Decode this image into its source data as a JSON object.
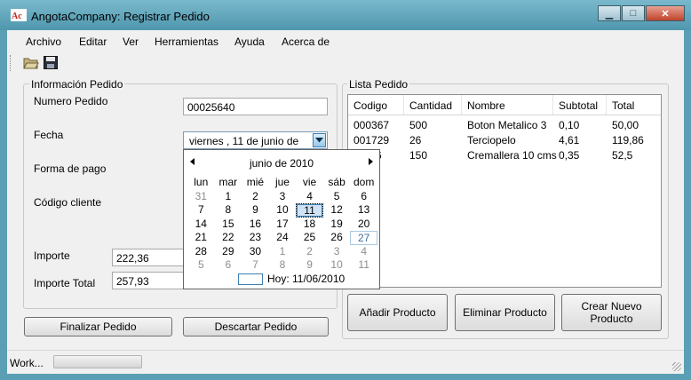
{
  "window": {
    "title": "AngotaCompany: Registrar Pedido",
    "controls": {
      "minimize": "▁",
      "maximize": "□",
      "close": "✕"
    }
  },
  "menu": [
    "Archivo",
    "Editar",
    "Ver",
    "Herramientas",
    "Ayuda",
    "Acerca de"
  ],
  "toolbar": {
    "icons": [
      "folder-open-icon",
      "save-icon"
    ]
  },
  "info_group": {
    "title": "Información Pedido",
    "numero_pedido_label": "Numero Pedido",
    "numero_pedido_value": "00025640",
    "fecha_label": "Fecha",
    "fecha_value": "viernes , 11 de     junio     de",
    "forma_pago_label": "Forma de pago",
    "codigo_cliente_label": "Código cliente",
    "importe_label": "Importe",
    "importe_value": "222,36",
    "importe_total_label": "Importe Total",
    "importe_total_value": "257,93"
  },
  "calendar": {
    "month_title": "junio de 2010",
    "days_of_week": [
      "lun",
      "mar",
      "mié",
      "jue",
      "vie",
      "sáb",
      "dom"
    ],
    "weeks": [
      [
        {
          "d": "31",
          "o": true
        },
        {
          "d": "1"
        },
        {
          "d": "2"
        },
        {
          "d": "3"
        },
        {
          "d": "4"
        },
        {
          "d": "5"
        },
        {
          "d": "6"
        }
      ],
      [
        {
          "d": "7"
        },
        {
          "d": "8"
        },
        {
          "d": "9"
        },
        {
          "d": "10"
        },
        {
          "d": "11",
          "s": true
        },
        {
          "d": "12"
        },
        {
          "d": "13"
        }
      ],
      [
        {
          "d": "14"
        },
        {
          "d": "15"
        },
        {
          "d": "16"
        },
        {
          "d": "17"
        },
        {
          "d": "18"
        },
        {
          "d": "19"
        },
        {
          "d": "20"
        }
      ],
      [
        {
          "d": "21"
        },
        {
          "d": "22"
        },
        {
          "d": "23"
        },
        {
          "d": "24"
        },
        {
          "d": "25"
        },
        {
          "d": "26"
        },
        {
          "d": "27",
          "t": true
        }
      ],
      [
        {
          "d": "28"
        },
        {
          "d": "29"
        },
        {
          "d": "30"
        },
        {
          "d": "1",
          "o": true
        },
        {
          "d": "2",
          "o": true
        },
        {
          "d": "3",
          "o": true
        },
        {
          "d": "4",
          "o": true
        }
      ],
      [
        {
          "d": "5",
          "o": true
        },
        {
          "d": "6",
          "o": true
        },
        {
          "d": "7",
          "o": true
        },
        {
          "d": "8",
          "o": true
        },
        {
          "d": "9",
          "o": true
        },
        {
          "d": "10",
          "o": true
        },
        {
          "d": "11",
          "o": true
        }
      ]
    ],
    "today_label": "Hoy: 11/06/2010"
  },
  "list_group": {
    "title": "Lista Pedido",
    "columns": [
      "Codigo",
      "Cantidad",
      "Nombre",
      "Subtotal",
      "Total"
    ],
    "rows": [
      [
        "000367",
        "500",
        "Boton Metalico 3",
        "0,10",
        "50,00"
      ],
      [
        "001729",
        "26",
        "Terciopelo",
        "4,61",
        "119,86"
      ],
      [
        "6",
        "150",
        "Cremallera 10 cms",
        "0,35",
        "52,5"
      ]
    ]
  },
  "buttons": {
    "finalizar": "Finalizar Pedido",
    "descartar": "Descartar Pedido",
    "anadir": "Añadir Producto",
    "eliminar": "Eliminar Producto",
    "crear": "Crear Nuevo Producto"
  },
  "status": {
    "text": "Work...",
    "progress": 0
  }
}
